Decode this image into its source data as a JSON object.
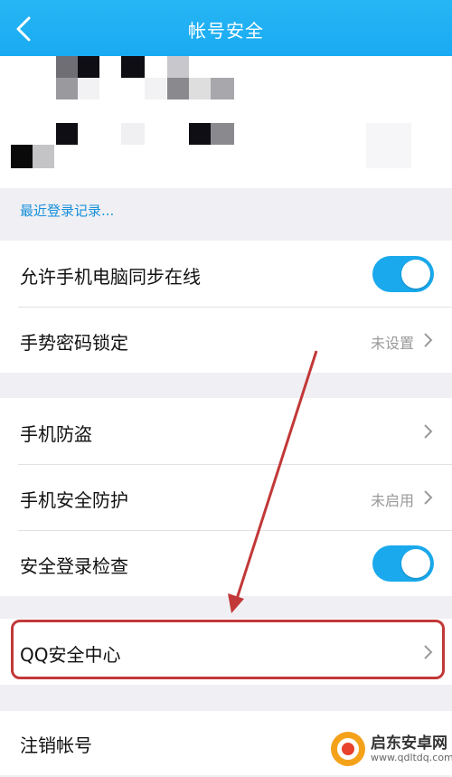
{
  "header": {
    "title": "帐号安全",
    "back_icon": "chevron-left-icon"
  },
  "device_link": "最近登录记录...",
  "group1": [
    {
      "label": "允许手机电脑同步在线",
      "toggle": true
    },
    {
      "label": "手势密码锁定",
      "value": "未设置"
    }
  ],
  "group2": [
    {
      "label": "手机防盗"
    },
    {
      "label": "手机安全防护",
      "value": "未启用"
    },
    {
      "label": "安全登录检查",
      "toggle": true
    }
  ],
  "group3": [
    {
      "label": "QQ安全中心"
    }
  ],
  "group4": [
    {
      "label": "注销帐号"
    }
  ],
  "watermark": {
    "title": "启东安卓网",
    "url": "www.qdltdq.com"
  },
  "colors": {
    "header": "#19aaf2",
    "toggle_on": "#19a9ec",
    "highlight": "#c23838"
  }
}
